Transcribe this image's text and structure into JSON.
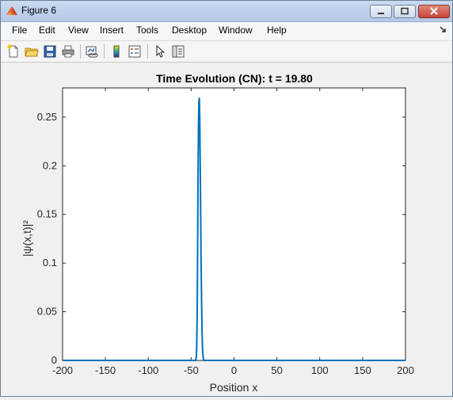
{
  "window": {
    "title": "Figure 6"
  },
  "menu": {
    "items": [
      "File",
      "Edit",
      "View",
      "Insert",
      "Tools",
      "Desktop",
      "Window",
      "Help"
    ]
  },
  "toolbar": {
    "buttons": [
      "new-figure-icon",
      "open-file-icon",
      "save-icon",
      "print-icon",
      "link-plot-icon",
      "colorbar-icon",
      "legend-icon",
      "pointer-icon",
      "property-inspector-icon"
    ]
  },
  "chart_data": {
    "type": "line",
    "title": "Time Evolution (CN): t = 19.80",
    "xlabel": "Position x",
    "ylabel": "|ψ(x,t)|²",
    "xlim": [
      -200,
      200
    ],
    "ylim": [
      0,
      0.28
    ],
    "xticks": [
      "-200",
      "-150",
      "-100",
      "-50",
      "0",
      "50",
      "100",
      "150",
      "200"
    ],
    "yticks": [
      "0",
      "0.05",
      "0.1",
      "0.15",
      "0.2",
      "0.25"
    ],
    "line_color": "#0072bd",
    "series": [
      {
        "x": [
          -200,
          -45,
          -44,
          -43.5,
          -43,
          -42.5,
          -42,
          -41.5,
          -41,
          -40.5,
          -40,
          -39.5,
          -39,
          -38.5,
          -38,
          -37.5,
          -37,
          -36.5,
          -36,
          -35.5,
          -35,
          200
        ],
        "y": [
          0,
          0,
          0.003,
          0.015,
          0.05,
          0.11,
          0.18,
          0.24,
          0.265,
          0.27,
          0.25,
          0.21,
          0.16,
          0.11,
          0.07,
          0.04,
          0.02,
          0.008,
          0.003,
          0.001,
          0,
          0
        ]
      }
    ]
  }
}
